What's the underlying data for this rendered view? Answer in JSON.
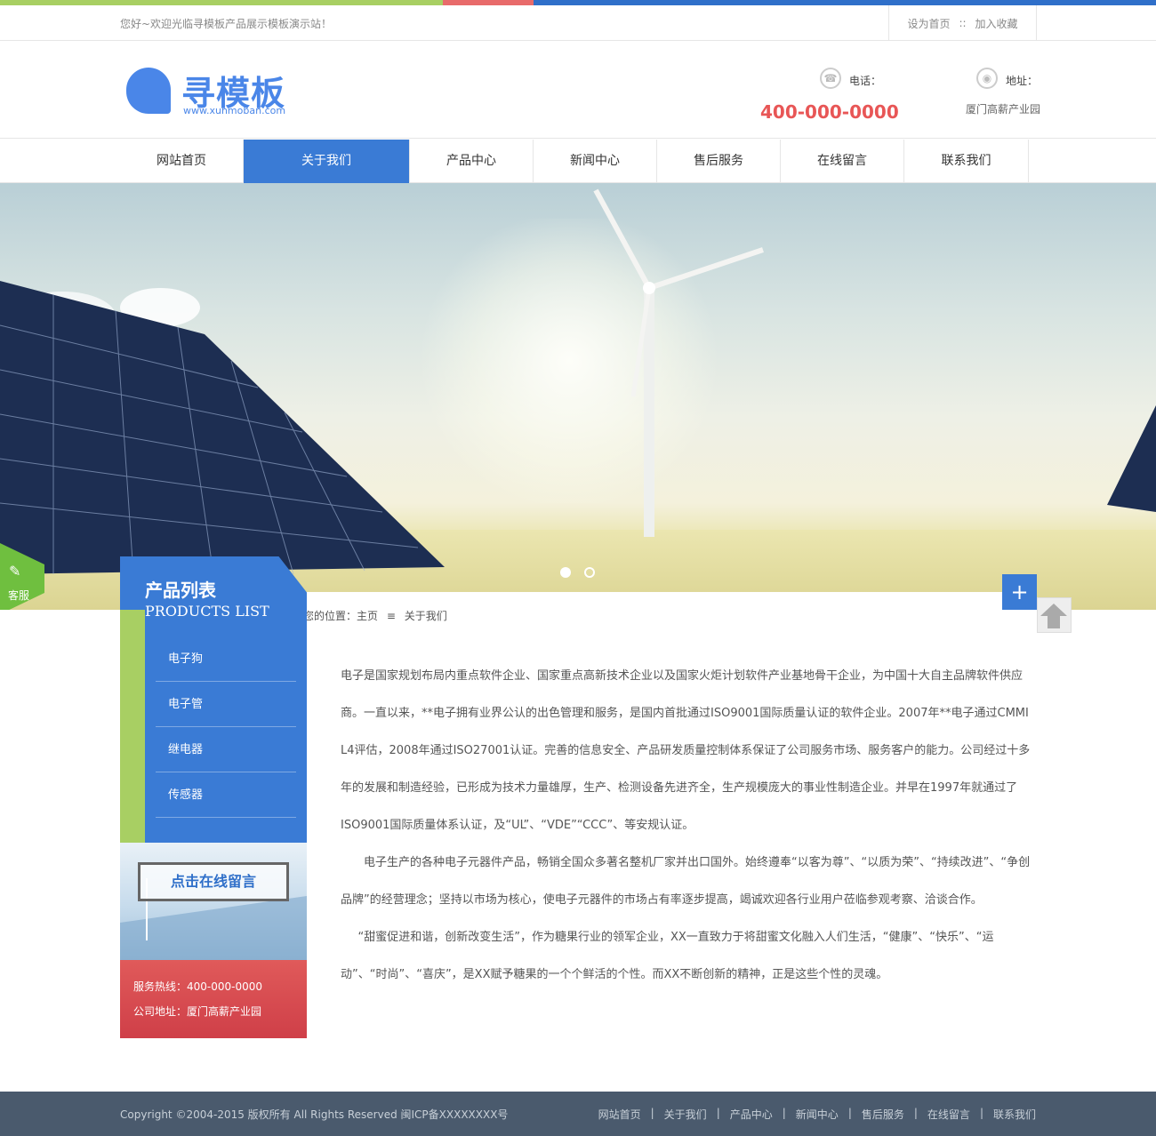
{
  "colors": {
    "primary": "#3a7bd5",
    "green": "#a8cf63",
    "red": "#e85656",
    "footer": "#4a5a6d"
  },
  "topbar": {
    "welcome": "您好~欢迎光临寻模板产品展示模板演示站！",
    "set_home": "设为首页",
    "separator": "::",
    "favorite": "加入收藏"
  },
  "header": {
    "logo_text": "寻模板",
    "logo_url": "www.xunmoban.com",
    "phone_label": "电话：",
    "phone": "400-000-0000",
    "address_label": "地址：",
    "address": "厦门高薪产业园"
  },
  "nav": [
    {
      "label": "网站首页",
      "active": false
    },
    {
      "label": "关于我们",
      "active": true
    },
    {
      "label": "产品中心",
      "active": false
    },
    {
      "label": "新闻中心",
      "active": false
    },
    {
      "label": "售后服务",
      "active": false
    },
    {
      "label": "在线留言",
      "active": false
    },
    {
      "label": "联系我们",
      "active": false
    }
  ],
  "banner": {
    "kefu_label": "客服",
    "dots": [
      "active",
      "inactive"
    ]
  },
  "sidebar": {
    "title": "产品列表",
    "subtitle": "PRODUCTS LIST",
    "items": [
      "电子狗",
      "电子管",
      "继电器",
      "传感器"
    ],
    "promo_label": "点击在线留言",
    "hotline": "服务热线：400-000-0000",
    "address": "公司地址：厦门高薪产业园"
  },
  "breadcrumb": {
    "prefix": "您的位置：",
    "home": "主页",
    "sep": "≡",
    "current": "关于我们"
  },
  "content": {
    "p1": "电子是国家规划布局内重点软件企业、国家重点高新技术企业以及国家火炬计划软件产业基地骨干企业，为中国十大自主品牌软件供应商。一直以来，**电子拥有业界公认的出色管理和服务，是国内首批通过ISO9001国际质量认证的软件企业。2007年**电子通过CMMI L4评估，2008年通过ISO27001认证。完善的信息安全、产品研发质量控制体系保证了公司服务市场、服务客户的能力。公司经过十多年的发展和制造经验，已形成为技术力量雄厚，生产、检测设备先进齐全，生产规模庞大的事业性制造企业。并早在1997年就通过了ISO9001国际质量体系认证，及“UL”、“VDE”“CCC”、等安规认证。",
    "p2": "电子生产的各种电子元器件产品，畅销全国众多著名整机厂家并出口国外。始终遵奉“以客为尊”、“以质为荣”、“持续改进”、“争创品牌”的经营理念；坚持以市场为核心，使电子元器件的市场占有率逐步提高，竭诚欢迎各行业用户莅临参观考察、洽谈合作。",
    "p3": "“甜蜜促进和谐，创新改变生活”，作为糖果行业的领军企业，XX一直致力于将甜蜜文化融入人们生活，“健康”、“快乐”、“运动”、“时尚”、“喜庆”，是XX赋予糖果的一个个鲜活的个性。而XX不断创新的精神，正是这些个性的灵魂。"
  },
  "float": {
    "plus": "+"
  },
  "footer": {
    "copyright": "Copyright ©2004-2015 版权所有 All Rights Reserved 闽ICP备XXXXXXXX号",
    "links": [
      "网站首页",
      "关于我们",
      "产品中心",
      "新闻中心",
      "售后服务",
      "在线留言",
      "联系我们"
    ],
    "sep": "|"
  }
}
